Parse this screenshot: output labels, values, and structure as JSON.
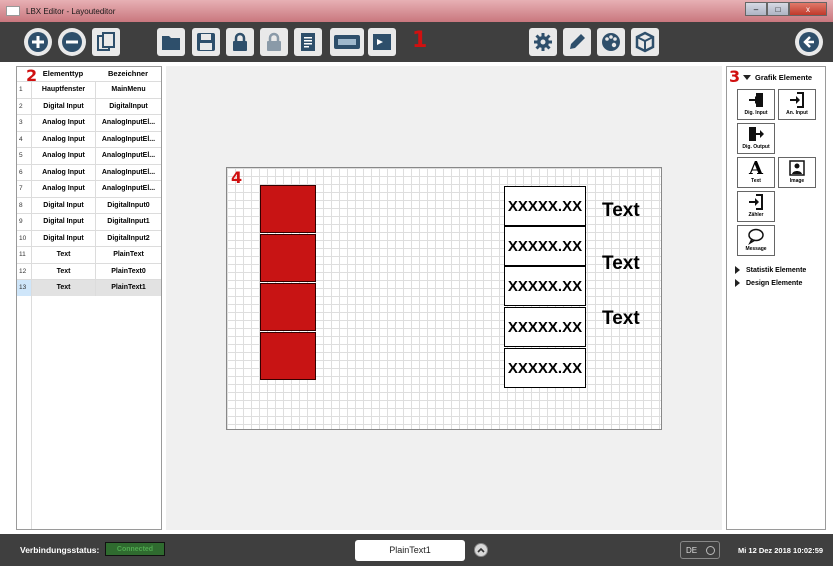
{
  "window": {
    "title": "LBX Editor - Layouteditor",
    "controls": [
      "–",
      "□",
      "x"
    ]
  },
  "toolbar": {
    "buttons": [
      "add",
      "remove",
      "copy",
      "open-folder",
      "save",
      "lock",
      "unlock",
      "document",
      "serial-port",
      "display",
      "settings",
      "edit",
      "palette",
      "cube",
      "back"
    ],
    "marker": "1"
  },
  "left_panel": {
    "marker": "2",
    "headers": [
      "Elementtyp",
      "Bezeichner"
    ],
    "rows": [
      {
        "n": "1",
        "type": "Hauptfenster",
        "name": "MainMenu"
      },
      {
        "n": "2",
        "type": "Digital Input",
        "name": "DigitalInput"
      },
      {
        "n": "3",
        "type": "Analog Input",
        "name": "AnalogInputEl..."
      },
      {
        "n": "4",
        "type": "Analog Input",
        "name": "AnalogInputEl..."
      },
      {
        "n": "5",
        "type": "Analog Input",
        "name": "AnalogInputEl..."
      },
      {
        "n": "6",
        "type": "Analog Input",
        "name": "AnalogInputEl..."
      },
      {
        "n": "7",
        "type": "Analog Input",
        "name": "AnalogInputEl..."
      },
      {
        "n": "8",
        "type": "Digital Input",
        "name": "DigitalInput0"
      },
      {
        "n": "9",
        "type": "Digital Input",
        "name": "DigitalInput1"
      },
      {
        "n": "10",
        "type": "Digital Input",
        "name": "DigitalInput2"
      },
      {
        "n": "11",
        "type": "Text",
        "name": "PlainText"
      },
      {
        "n": "12",
        "type": "Text",
        "name": "PlainText0"
      },
      {
        "n": "13",
        "type": "Text",
        "name": "PlainText1"
      }
    ],
    "selected_row": "13"
  },
  "canvas": {
    "marker": "4",
    "values": [
      "XXXXX.XX",
      "XXXXX.XX",
      "XXXXX.XX",
      "XXXXX.XX",
      "XXXXX.XX"
    ],
    "texts": [
      "Text",
      "Text",
      "Text"
    ],
    "red_color": "#c81414"
  },
  "right_panel": {
    "marker": "3",
    "title": "Grafik Elemente",
    "items": [
      "Dig. Input",
      "An. Input",
      "Dig. Output",
      "Text",
      "Image",
      "Zähler",
      "Message"
    ],
    "sections": [
      "Statistik Elemente",
      "Design Elemente"
    ]
  },
  "status_bar": {
    "label": "Verbindungsstatus:",
    "connection": "Connected",
    "current_element": "PlainText1",
    "language": "DE",
    "datetime": "Mi 12 Dez 2018 10:02:59"
  }
}
